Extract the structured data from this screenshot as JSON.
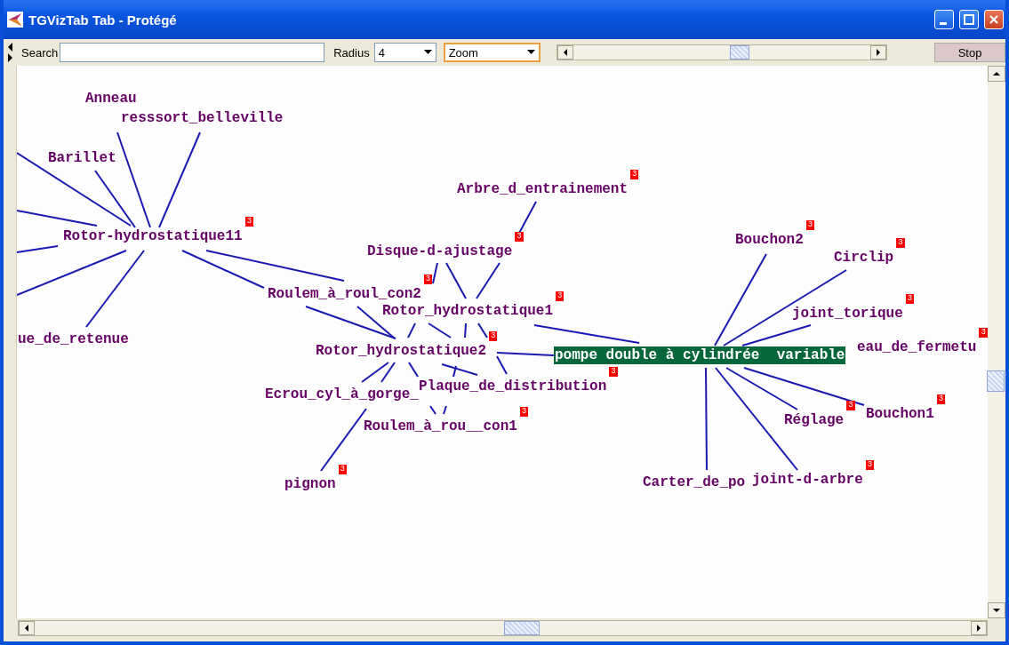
{
  "window": {
    "title": "TGVizTab Tab - Protégé"
  },
  "toolbar": {
    "search_label": "Search",
    "radius_label": "Radius",
    "radius_value": "4",
    "mode_value": "Zoom",
    "zoom_slider": {
      "level": 0.56
    },
    "stop_button": "Stop"
  },
  "graph": {
    "nodes": [
      {
        "label": "Anneau",
        "selected": false
      },
      {
        "label": "resssort_belleville",
        "selected": false
      },
      {
        "label": "Barillet",
        "selected": false
      },
      {
        "label": "Rotor-hydrostatique11",
        "badge": "3",
        "selected": false
      },
      {
        "label": "ue_de_retenue",
        "selected": false
      },
      {
        "label": "Arbre_d_entrainement",
        "badge": "3",
        "selected": false
      },
      {
        "label": "Disque-d-ajustage",
        "badge": "3",
        "selected": false
      },
      {
        "label": "Roulem_à_roul_con2",
        "badge": "3",
        "selected": false
      },
      {
        "label": "Rotor_hydrostatique1",
        "badge": "3",
        "selected": false
      },
      {
        "label": "Rotor_hydrostatique2",
        "badge": "3",
        "selected": false
      },
      {
        "label": "pompe double à cylindrée  variable",
        "selected": true
      },
      {
        "label": "eau_de_fermetu",
        "badge": "3",
        "selected": false
      },
      {
        "label": "Ecrou_cyl_à_gorge_",
        "selected": false
      },
      {
        "label": "Plaque_de_distribution",
        "badge": "3",
        "selected": false
      },
      {
        "label": "Roulem_à_rou__con1",
        "badge": "3",
        "selected": false
      },
      {
        "label": "pignon",
        "badge": "3",
        "selected": false
      },
      {
        "label": "Bouchon2",
        "badge": "3",
        "selected": false
      },
      {
        "label": "Circlip",
        "badge": "3",
        "selected": false
      },
      {
        "label": "joint_torique",
        "badge": "3",
        "selected": false
      },
      {
        "label": "Réglage",
        "badge": "3",
        "selected": false
      },
      {
        "label": "Bouchon1",
        "badge": "3",
        "selected": false
      },
      {
        "label": "Carter_de_po",
        "selected": false
      },
      {
        "label": "joint-d-arbre",
        "badge": "3",
        "selected": false
      }
    ]
  }
}
